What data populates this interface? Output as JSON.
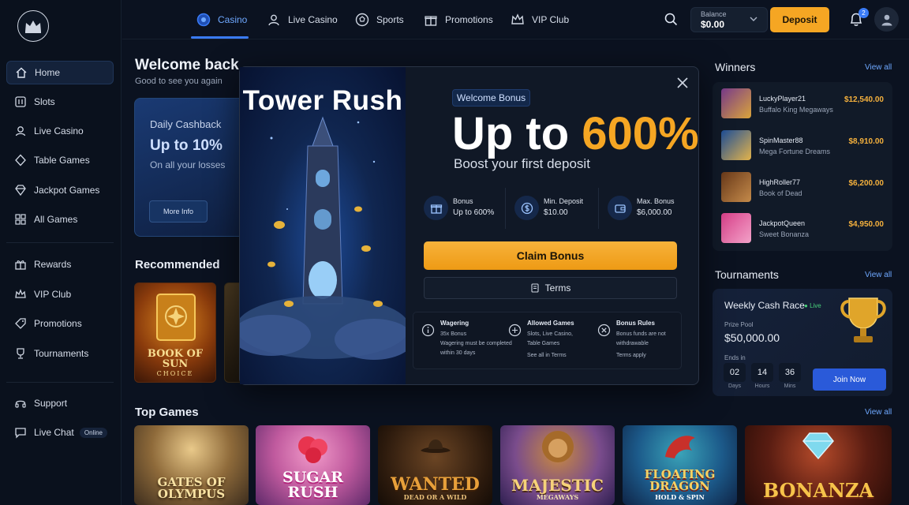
{
  "topnav": {
    "tabs": [
      {
        "label": "Casino",
        "icon": "casino-chip-icon",
        "active": true
      },
      {
        "label": "Live Casino",
        "icon": "live-dealer-icon"
      },
      {
        "label": "Sports",
        "icon": "soccer-ball-icon"
      },
      {
        "label": "Promotions",
        "icon": "gift-icon"
      },
      {
        "label": "VIP Club",
        "icon": "crown-icon"
      }
    ],
    "balance_label": "Balance",
    "balance_value": "$0.00",
    "deposit_label": "Deposit",
    "notifications_count": "2"
  },
  "sidebar": {
    "items": [
      {
        "label": "Home",
        "icon": "home-icon",
        "active": true
      },
      {
        "label": "Slots",
        "icon": "slots-icon"
      },
      {
        "label": "Live Casino",
        "icon": "live-dealer-icon"
      },
      {
        "label": "Table Games",
        "icon": "cards-icon"
      },
      {
        "label": "Jackpot Games",
        "icon": "diamond-icon"
      },
      {
        "label": "All Games",
        "icon": "grid-icon"
      }
    ],
    "items2": [
      {
        "label": "Rewards",
        "icon": "gift-icon"
      },
      {
        "label": "VIP Club",
        "icon": "crown-icon"
      },
      {
        "label": "Promotions",
        "icon": "tag-icon"
      },
      {
        "label": "Tournaments",
        "icon": "trophy-icon"
      }
    ],
    "support": [
      {
        "label": "Support",
        "icon": "headset-icon"
      },
      {
        "label": "Live Chat",
        "icon": "chat-icon",
        "badge": "Online"
      }
    ]
  },
  "main": {
    "welcome_title": "Welcome back",
    "welcome_sub": "Good to see you again",
    "cashback": {
      "title": "Daily Cashback",
      "amount": "Up to 10%",
      "desc": "On all your losses",
      "button": "More Info"
    },
    "recommended_title": "Recommended",
    "recommended_games": [
      {
        "label": "BOOK OF SUN",
        "sub": "CHOICE"
      }
    ],
    "top_games_title": "Top Games",
    "top_games_view_all": "View all",
    "top_games": [
      {
        "label": "GATES OF OLYMPUS"
      },
      {
        "label": "SUGAR RUSH"
      },
      {
        "label": "WANTED",
        "sub": "DEAD OR A WILD"
      },
      {
        "label": "MAJESTIC",
        "sub": "MEGAWAYS"
      },
      {
        "label": "FLOATING DRAGON",
        "sub": "HOLD & SPIN"
      },
      {
        "label": "BONANZA"
      }
    ]
  },
  "winners": {
    "title": "Winners",
    "view_all": "View all",
    "rows": [
      {
        "user": "LuckyPlayer21",
        "game": "Buffalo King Megaways",
        "amount": "$12,540.00"
      },
      {
        "user": "SpinMaster88",
        "game": "Mega Fortune Dreams",
        "amount": "$8,910.00"
      },
      {
        "user": "HighRoller77",
        "game": "Book of Dead",
        "amount": "$6,200.00"
      },
      {
        "user": "JackpotQueen",
        "game": "Sweet Bonanza",
        "amount": "$4,950.00"
      }
    ]
  },
  "tournaments": {
    "title": "Tournaments",
    "view_all": "View all",
    "name": "Weekly Cash Race",
    "live": "Live",
    "prize_label": "Prize Pool",
    "prize": "$50,000.00",
    "ends_label": "Ends in",
    "countdown": [
      {
        "value": "02",
        "unit": "Days"
      },
      {
        "value": "14",
        "unit": "Hours"
      },
      {
        "value": "36",
        "unit": "Mins"
      }
    ],
    "join_label": "Join Now"
  },
  "modal": {
    "game_title": "Tower Rush",
    "pill": "Welcome Bonus",
    "headline_pre": "Up to ",
    "headline_accent": "600%",
    "subhead": "Boost your first deposit",
    "stats": [
      {
        "icon": "gift-icon",
        "l1": "Bonus",
        "l2": "Up to 600%"
      },
      {
        "icon": "dollar-icon",
        "l1": "Min. Deposit",
        "l2": "$10.00"
      },
      {
        "icon": "wallet-icon",
        "l1": "Max. Bonus",
        "l2": "$6,000.00"
      }
    ],
    "claim_label": "Claim Bonus",
    "terms_label": "Terms",
    "info": [
      {
        "title": "Wagering",
        "lines": [
          "35x Bonus",
          "Wagering must be completed",
          "within 30 days"
        ]
      },
      {
        "title": "Allowed Games",
        "lines": [
          "Slots, Live Casino,",
          "Table Games",
          "See all in Terms"
        ]
      },
      {
        "title": "Bonus Rules",
        "lines": [
          "Bonus funds are not",
          "withdrawable",
          "Terms apply"
        ]
      }
    ]
  },
  "colors": {
    "accent_blue": "#3a7bf6",
    "accent_gold": "#f5a623",
    "background": "#0b1220"
  }
}
